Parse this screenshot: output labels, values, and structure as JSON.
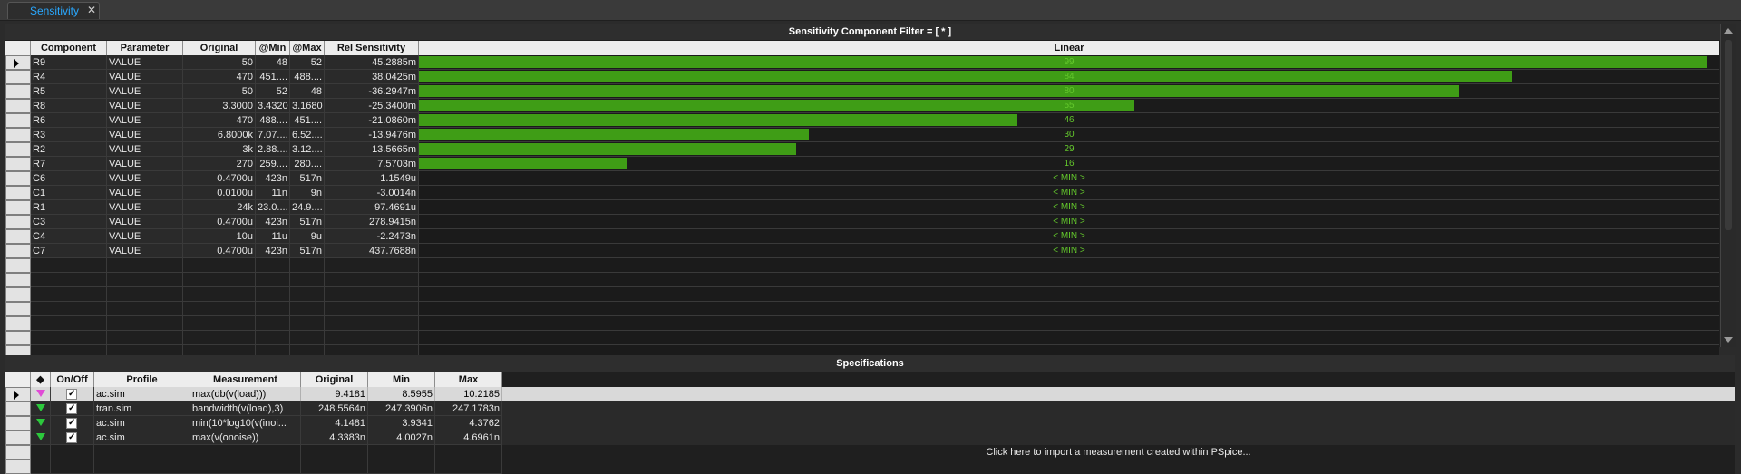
{
  "tab": {
    "label": "Sensitivity",
    "close": "✕"
  },
  "sensitivity": {
    "title": "Sensitivity Component Filter = [ * ]",
    "columns": [
      "Component",
      "Parameter",
      "Original",
      "@Min",
      "@Max",
      "Rel Sensitivity",
      "Linear"
    ],
    "rows": [
      {
        "component": "R9",
        "parameter": "VALUE",
        "original": "50",
        "min": "48",
        "max": "52",
        "rel": "45.2885m",
        "linear": "99",
        "bar": 0.99
      },
      {
        "component": "R4",
        "parameter": "VALUE",
        "original": "470",
        "min": "451....",
        "max": "488....",
        "rel": "38.0425m",
        "linear": "84",
        "bar": 0.84
      },
      {
        "component": "R5",
        "parameter": "VALUE",
        "original": "50",
        "min": "52",
        "max": "48",
        "rel": "-36.2947m",
        "linear": "80",
        "bar": 0.8
      },
      {
        "component": "R8",
        "parameter": "VALUE",
        "original": "3.3000",
        "min": "3.4320",
        "max": "3.1680",
        "rel": "-25.3400m",
        "linear": "55",
        "bar": 0.55
      },
      {
        "component": "R6",
        "parameter": "VALUE",
        "original": "470",
        "min": "488....",
        "max": "451....",
        "rel": "-21.0860m",
        "linear": "46",
        "bar": 0.46
      },
      {
        "component": "R3",
        "parameter": "VALUE",
        "original": "6.8000k",
        "min": "7.07....",
        "max": "6.52....",
        "rel": "-13.9476m",
        "linear": "30",
        "bar": 0.3
      },
      {
        "component": "R2",
        "parameter": "VALUE",
        "original": "3k",
        "min": "2.88....",
        "max": "3.12....",
        "rel": "13.5665m",
        "linear": "29",
        "bar": 0.29
      },
      {
        "component": "R7",
        "parameter": "VALUE",
        "original": "270",
        "min": "259....",
        "max": "280....",
        "rel": "7.5703m",
        "linear": "16",
        "bar": 0.16
      },
      {
        "component": "C6",
        "parameter": "VALUE",
        "original": "0.4700u",
        "min": "423n",
        "max": "517n",
        "rel": "1.1549u",
        "linear": "< MIN >",
        "bar": 0
      },
      {
        "component": "C1",
        "parameter": "VALUE",
        "original": "0.0100u",
        "min": "11n",
        "max": "9n",
        "rel": "-3.0014n",
        "linear": "< MIN >",
        "bar": 0
      },
      {
        "component": "R1",
        "parameter": "VALUE",
        "original": "24k",
        "min": "23.0....",
        "max": "24.9....",
        "rel": "97.4691u",
        "linear": "< MIN >",
        "bar": 0
      },
      {
        "component": "C3",
        "parameter": "VALUE",
        "original": "0.4700u",
        "min": "423n",
        "max": "517n",
        "rel": "278.9415n",
        "linear": "< MIN >",
        "bar": 0
      },
      {
        "component": "C4",
        "parameter": "VALUE",
        "original": "10u",
        "min": "11u",
        "max": "9u",
        "rel": "-2.2473n",
        "linear": "< MIN >",
        "bar": 0
      },
      {
        "component": "C7",
        "parameter": "VALUE",
        "original": "0.4700u",
        "min": "423n",
        "max": "517n",
        "rel": "437.7688n",
        "linear": "< MIN >",
        "bar": 0
      }
    ],
    "bar_color": "#3f9d16",
    "bar_label_color": "#63c72c"
  },
  "specifications": {
    "title": "Specifications",
    "columns": [
      "",
      "On/Off",
      "Profile",
      "Measurement",
      "Original",
      "Min",
      "Max"
    ],
    "header_marker": "◆",
    "rows": [
      {
        "flag": "magenta",
        "checked": true,
        "profile": "ac.sim",
        "measurement": "max(db(v(load)))",
        "original": "9.4181",
        "min": "8.5955",
        "max": "10.2185"
      },
      {
        "flag": "green",
        "checked": true,
        "profile": "tran.sim",
        "measurement": "bandwidth(v(load),3)",
        "original": "248.5564n",
        "min": "247.3906n",
        "max": "247.1783n"
      },
      {
        "flag": "green",
        "checked": true,
        "profile": "ac.sim",
        "measurement": "min(10*log10(v(inoi...",
        "original": "4.1481",
        "min": "3.9341",
        "max": "4.3762"
      },
      {
        "flag": "green",
        "checked": true,
        "profile": "ac.sim",
        "measurement": "max(v(onoise))",
        "original": "4.3383n",
        "min": "4.0027n",
        "max": "4.6961n"
      }
    ],
    "import_text": "Click here to import a measurement created within PSpice...",
    "checkmark": "✓"
  }
}
